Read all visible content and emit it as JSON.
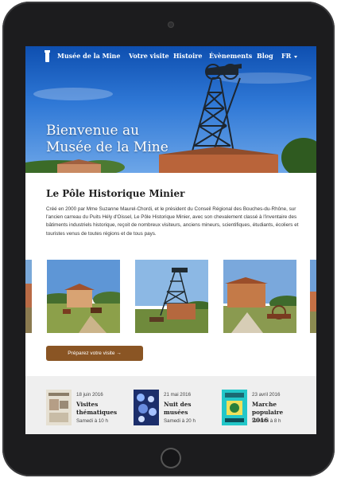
{
  "nav": {
    "brand": "Musée de la Mine",
    "items": [
      {
        "label": "Votre visite"
      },
      {
        "label": "Histoire"
      },
      {
        "label": "Évènements"
      },
      {
        "label": "Blog"
      }
    ],
    "language": "FR"
  },
  "hero": {
    "title_line1": "Bienvenue au",
    "title_line2": "Musée de la Mine"
  },
  "intro": {
    "title": "Le Pôle Historique Minier",
    "body": "Créé en 2000 par Mme Suzanne Maurel-Chordi, et le président du Conseil Régional des Bouches-du-Rhône, sur l'ancien carreau du Puits Hély d'Oissel, Le Pôle Historique Minier, avec son chevalement classé à l'inventaire des bâtiments industriels historique, reçoit de nombreux visiteurs, anciens mineurs, scientifiques, étudiants, écoliers et touristes venus de toutes régions et de tous pays."
  },
  "cta": {
    "label": "Préparez votre visite →"
  },
  "events": [
    {
      "date": "18 juin 2016",
      "title": "Visites thématiques",
      "time": "Samedi à 10 h"
    },
    {
      "date": "21 mai 2016",
      "title": "Nuit des musées",
      "time": "Samedi à 20 h"
    },
    {
      "date": "23 avril 2016",
      "title": "Marche populaire 2016",
      "time": "Samedi à 8 h"
    }
  ],
  "colors": {
    "accent": "#8a5524",
    "sky": "#2f78d6",
    "events_bg": "#efefef"
  }
}
